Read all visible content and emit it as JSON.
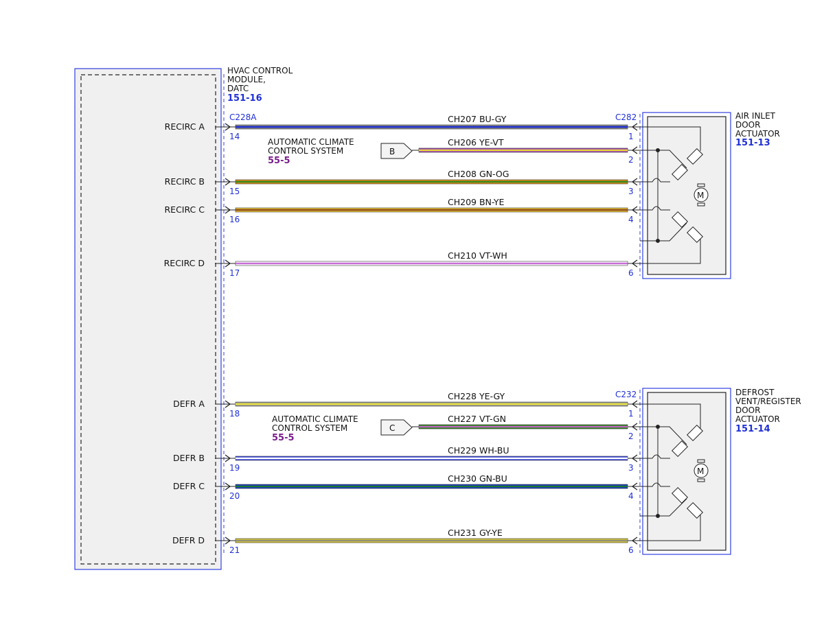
{
  "module": {
    "name_lines": [
      "HVAC CONTROL",
      "MODULE,",
      "DATC"
    ],
    "ref": "151-16",
    "connector": "C228A"
  },
  "actuators": [
    {
      "name_lines": [
        "AIR INLET",
        "DOOR",
        "ACTUATOR"
      ],
      "ref": "151-13",
      "connector": "C282",
      "motor": "M"
    },
    {
      "name_lines": [
        "DEFROST",
        "VENT/REGISTER",
        "DOOR",
        "ACTUATOR"
      ],
      "ref": "151-14",
      "connector": "C232",
      "motor": "M"
    }
  ],
  "offpage": [
    {
      "letter": "B",
      "lines": [
        "AUTOMATIC CLIMATE",
        "CONTROL SYSTEM"
      ],
      "ref": "55-5"
    },
    {
      "letter": "C",
      "lines": [
        "AUTOMATIC CLIMATE",
        "CONTROL SYSTEM"
      ],
      "ref": "55-5"
    }
  ],
  "wires": [
    {
      "circuit": "CH207",
      "color": "BU-GY",
      "signal": "RECIRC A",
      "module_pin": "14",
      "actuator_pin": "1",
      "stripe": [
        "#1a2ad0",
        "#8a8a8a"
      ]
    },
    {
      "circuit": "CH206",
      "color": "YE-VT",
      "signal": "",
      "module_pin": "",
      "actuator_pin": "2",
      "stripe": [
        "#e8d53a",
        "#a24bb5"
      ]
    },
    {
      "circuit": "CH208",
      "color": "GN-OG",
      "signal": "RECIRC B",
      "module_pin": "15",
      "actuator_pin": "3",
      "stripe": [
        "#2e8b1f",
        "#e38a1a"
      ]
    },
    {
      "circuit": "CH209",
      "color": "BN-YE",
      "signal": "RECIRC C",
      "module_pin": "16",
      "actuator_pin": "4",
      "stripe": [
        "#8b4a1b",
        "#e8c23a"
      ]
    },
    {
      "circuit": "CH210",
      "color": "VT-WH",
      "signal": "RECIRC D",
      "module_pin": "17",
      "actuator_pin": "6",
      "stripe": [
        "#c86bd8",
        "#ffffff"
      ]
    },
    {
      "circuit": "CH228",
      "color": "YE-GY",
      "signal": "DEFR A",
      "module_pin": "18",
      "actuator_pin": "1",
      "stripe": [
        "#e8e23a",
        "#9a9a9a"
      ]
    },
    {
      "circuit": "CH227",
      "color": "VT-GN",
      "signal": "",
      "module_pin": "",
      "actuator_pin": "2",
      "stripe": [
        "#c063c4",
        "#2e8b1f"
      ]
    },
    {
      "circuit": "CH229",
      "color": "WH-BU",
      "signal": "DEFR B",
      "module_pin": "19",
      "actuator_pin": "3",
      "stripe": [
        "#ffffff",
        "#3a4ad8"
      ]
    },
    {
      "circuit": "CH230",
      "color": "GN-BU",
      "signal": "DEFR C",
      "module_pin": "20",
      "actuator_pin": "4",
      "stripe": [
        "#1c7a2a",
        "#1a3ad0"
      ]
    },
    {
      "circuit": "CH231",
      "color": "GY-YE",
      "signal": "DEFR D",
      "module_pin": "21",
      "actuator_pin": "6",
      "stripe": [
        "#8f8f7a",
        "#d8c83a"
      ]
    }
  ],
  "colors": {
    "connector_blue": "#1f2fd6",
    "ref_blue": "#1f2fd6",
    "ref_purple": "#7a1d8c",
    "module_fill": "#f0f0f0"
  }
}
